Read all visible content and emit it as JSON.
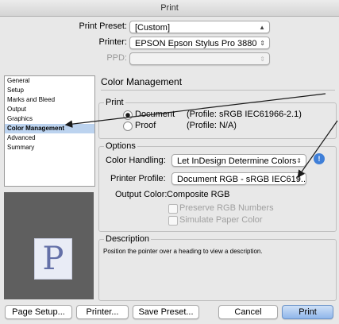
{
  "window": {
    "title": "Print"
  },
  "top": {
    "print_preset_label": "Print Preset:",
    "print_preset_value": "[Custom]",
    "printer_label": "Printer:",
    "printer_value": "EPSON Epson Stylus Pro 3880",
    "ppd_label": "PPD:",
    "ppd_value": ""
  },
  "sidebar": {
    "items": [
      {
        "label": "General"
      },
      {
        "label": "Setup"
      },
      {
        "label": "Marks and Bleed"
      },
      {
        "label": "Output"
      },
      {
        "label": "Graphics"
      },
      {
        "label": "Color Management",
        "selected": true
      },
      {
        "label": "Advanced"
      },
      {
        "label": "Summary"
      }
    ]
  },
  "preview": {
    "letter": "P"
  },
  "color_management": {
    "title": "Color Management",
    "print_group": {
      "legend": "Print",
      "document_label": "Document",
      "document_profile": "(Profile: sRGB IEC61966-2.1)",
      "proof_label": "Proof",
      "proof_profile": "(Profile: N/A)"
    },
    "options_group": {
      "legend": "Options",
      "color_handling_label": "Color Handling:",
      "color_handling_value": "Let InDesign Determine Colors",
      "printer_profile_label": "Printer Profile:",
      "printer_profile_value": "Document RGB - sRGB IEC619...",
      "output_color_label": "Output Color:",
      "output_color_value": "Composite RGB",
      "preserve_rgb_label": "Preserve RGB Numbers",
      "simulate_paper_label": "Simulate Paper Color"
    },
    "description_group": {
      "legend": "Description",
      "text": "Position the pointer over a heading to view a description."
    }
  },
  "buttons": {
    "page_setup": "Page Setup...",
    "printer": "Printer...",
    "save_preset": "Save Preset...",
    "cancel": "Cancel",
    "print": "Print"
  },
  "colors": {
    "accent": "#3f7fd8",
    "selection": "#bcd3ef",
    "arrow": "#1a1a1a"
  }
}
